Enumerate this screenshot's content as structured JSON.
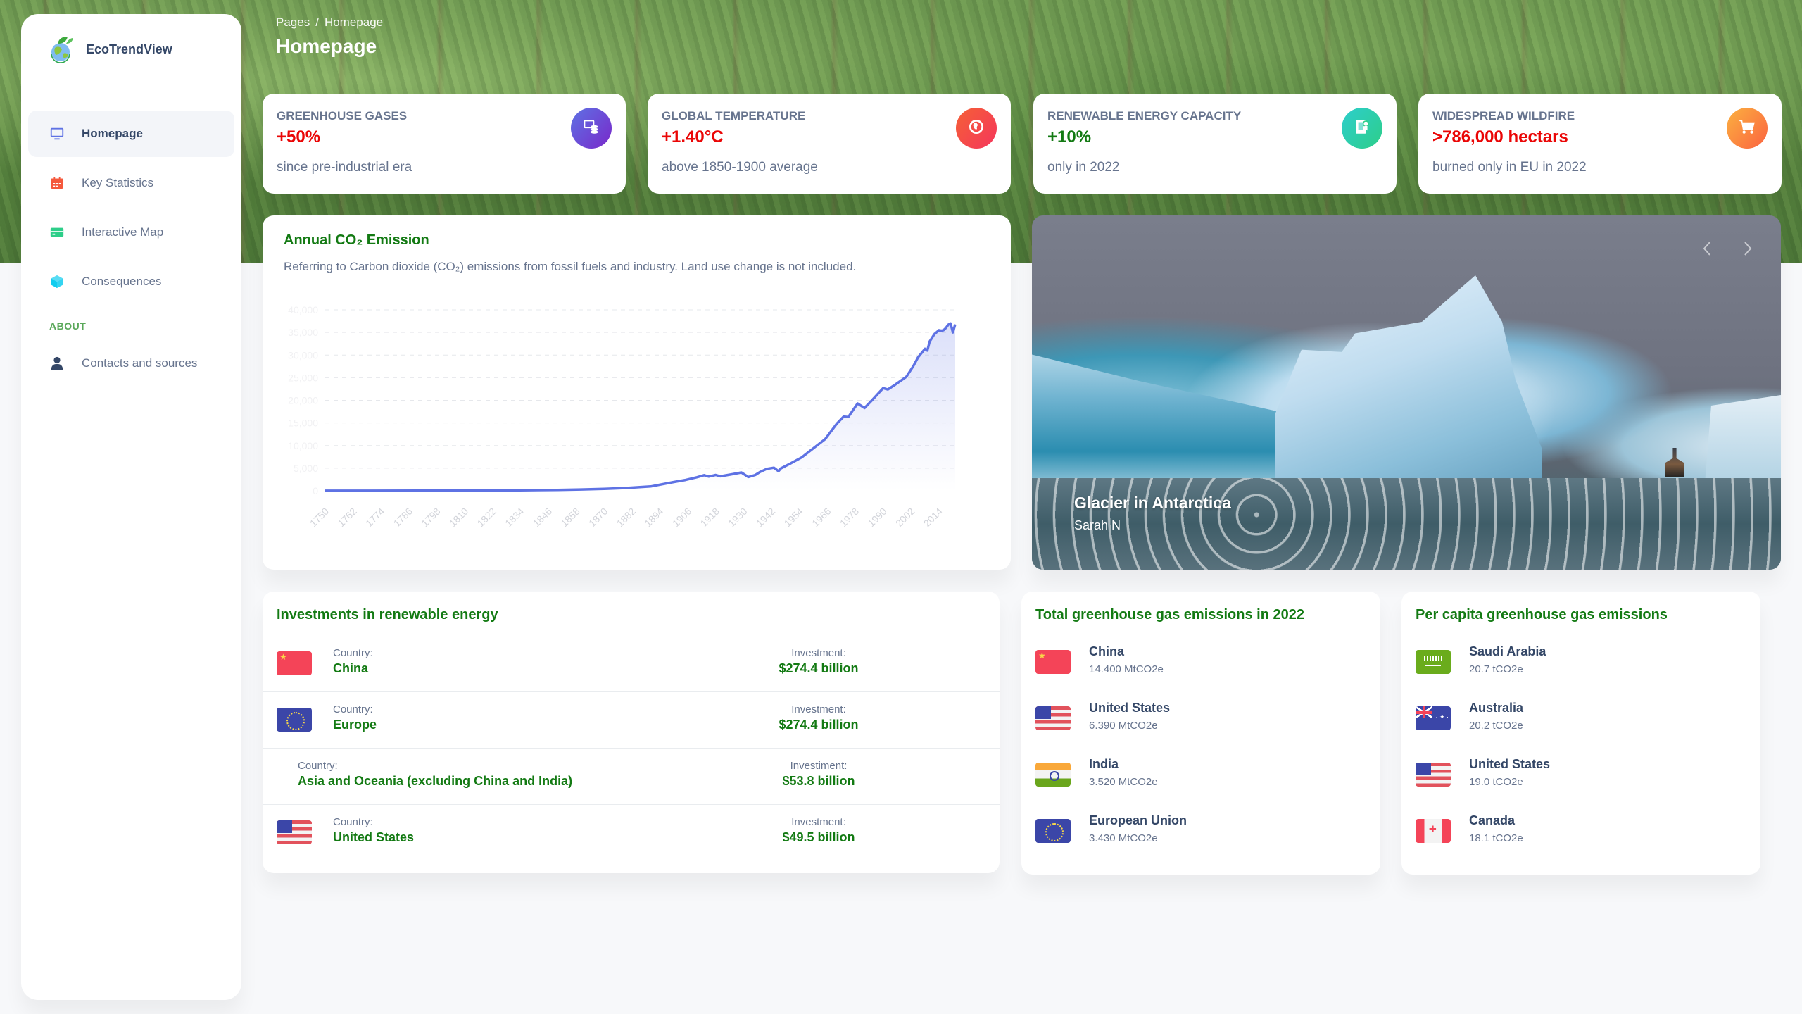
{
  "brand": {
    "name": "EcoTrendView",
    "logo_icon": "globe-leaf-icon"
  },
  "sidebar": {
    "items": [
      {
        "label": "Homepage",
        "icon": "monitor-icon",
        "icon_color": "#5e72e4",
        "active": true
      },
      {
        "label": "Key Statistics",
        "icon": "calendar-icon",
        "icon_color": "#f5593d",
        "active": false
      },
      {
        "label": "Interactive Map",
        "icon": "credit-card-icon",
        "icon_color": "#2dce89",
        "active": false
      },
      {
        "label": "Consequences",
        "icon": "box-icon",
        "icon_color": "#11cdef",
        "active": false
      }
    ],
    "section_label": "ABOUT",
    "about_items": [
      {
        "label": "Contacts and sources",
        "icon": "user-icon",
        "icon_color": "#344767"
      }
    ]
  },
  "header": {
    "breadcrumb": [
      "Pages",
      "Homepage"
    ],
    "breadcrumb_separator": "/",
    "title": "Homepage"
  },
  "stats": [
    {
      "title": "GREENHOUSE GASES",
      "value": "+50%",
      "value_color": "#ea0606",
      "subtitle": "since pre-industrial era",
      "icon": "money-coins-icon",
      "gradient": [
        "#7928ca",
        "#5e72e4"
      ]
    },
    {
      "title": "GLOBAL TEMPERATURE",
      "value": "+1.40°C",
      "value_color": "#ea0606",
      "subtitle": "above 1850-1900 average",
      "icon": "world-icon",
      "gradient": [
        "#f5365c",
        "#f56036"
      ]
    },
    {
      "title": "RENEWABLE ENERGY CAPACITY",
      "value": "+10%",
      "value_color": "#137a13",
      "subtitle": "only in 2022",
      "icon": "paper-diploma-icon",
      "gradient": [
        "#2dce89",
        "#2dcecc"
      ]
    },
    {
      "title": "WIDESPREAD WILDFIRE",
      "value": ">786,000 hectars",
      "value_color": "#ea0606",
      "subtitle": "burned only in EU in 2022",
      "icon": "cart-icon",
      "gradient": [
        "#fb6340",
        "#fbb140"
      ]
    }
  ],
  "chart_card": {
    "title": "Annual CO₂ Emission",
    "subtitle": "Referring to Carbon dioxide (CO₂) emissions from fossil fuels and industry. Land use change is not included."
  },
  "chart_data": {
    "type": "area",
    "title": "Annual CO₂ Emission",
    "xlabel": "",
    "ylabel": "",
    "xlim": [
      1750,
      2021
    ],
    "ylim": [
      0,
      40000
    ],
    "grid": true,
    "legend": "none",
    "line_color": "#5e72e4",
    "y_ticks": [
      0,
      5000,
      10000,
      15000,
      20000,
      25000,
      30000,
      35000,
      40000
    ],
    "y_tick_labels": [
      "0",
      "5,000",
      "10,000",
      "15,000",
      "20,000",
      "25,000",
      "30,000",
      "35,000",
      "40,000"
    ],
    "x_tick_labels": [
      "1750",
      "1762",
      "1774",
      "1786",
      "1798",
      "1810",
      "1822",
      "1834",
      "1846",
      "1858",
      "1870",
      "1882",
      "1894",
      "1906",
      "1918",
      "1930",
      "1942",
      "1954",
      "1966",
      "1978",
      "1990",
      "2002",
      "2014"
    ],
    "series": [
      {
        "name": "Annual CO₂ emissions (Mt)",
        "x": [
          1750,
          1770,
          1790,
          1810,
          1830,
          1850,
          1860,
          1870,
          1880,
          1890,
          1900,
          1905,
          1910,
          1913,
          1915,
          1918,
          1920,
          1925,
          1929,
          1932,
          1935,
          1937,
          1940,
          1943,
          1945,
          1946,
          1950,
          1955,
          1960,
          1965,
          1970,
          1973,
          1975,
          1979,
          1982,
          1985,
          1990,
          1992,
          1995,
          2000,
          2003,
          2005,
          2008,
          2009,
          2010,
          2012,
          2014,
          2015,
          2016,
          2017,
          2018,
          2019,
          2020,
          2021
        ],
        "y": [
          9,
          15,
          25,
          45,
          90,
          200,
          290,
          440,
          640,
          970,
          1950,
          2400,
          3000,
          3450,
          3150,
          3500,
          3200,
          3650,
          4050,
          3050,
          3500,
          4150,
          4850,
          5100,
          4350,
          4950,
          6000,
          7400,
          9400,
          11400,
          14800,
          16400,
          16300,
          19300,
          18300,
          19900,
          22700,
          22400,
          23400,
          25200,
          27600,
          29500,
          31400,
          31000,
          33000,
          34600,
          35500,
          35400,
          35500,
          36000,
          36700,
          37000,
          35000,
          36800
        ]
      }
    ]
  },
  "carousel": {
    "title": "Glacier in Antarctica",
    "subtitle": "Sarah N",
    "prev_icon": "chevron-left-icon",
    "next_icon": "chevron-right-icon"
  },
  "investments": {
    "title": "Investments in renewable energy",
    "rows": [
      {
        "flag": "cn",
        "country_label": "Country:",
        "country": "China",
        "investment_label": "Investment:",
        "investment": "$274.4 billion"
      },
      {
        "flag": "eu",
        "country_label": "Country:",
        "country": "Europe",
        "investment_label": "Investment:",
        "investment": "$274.4 billion"
      },
      {
        "flag": "",
        "country_label": "Country:",
        "country": "Asia and Oceania (excluding China and India)",
        "investment_label": "Investiment:",
        "investment": "$53.8 billion"
      },
      {
        "flag": "us",
        "country_label": "Country:",
        "country": "United States",
        "investment_label": "Investment:",
        "investment": "$49.5 billion"
      }
    ]
  },
  "total_emissions": {
    "title": "Total greenhouse gas emissions in 2022",
    "items": [
      {
        "flag": "cn",
        "name": "China",
        "value": "14.400 MtCO2e"
      },
      {
        "flag": "us",
        "name": "United States",
        "value": "6.390 MtCO2e"
      },
      {
        "flag": "in",
        "name": "India",
        "value": "3.520 MtCO2e"
      },
      {
        "flag": "eu",
        "name": "European Union",
        "value": "3.430 MtCO2e"
      }
    ]
  },
  "per_capita": {
    "title": "Per capita greenhouse gas emissions",
    "items": [
      {
        "flag": "sa",
        "name": "Saudi Arabia",
        "value": "20.7 tCO2e"
      },
      {
        "flag": "au",
        "name": "Australia",
        "value": "20.2 tCO2e"
      },
      {
        "flag": "us",
        "name": "United States",
        "value": "19.0 tCO2e"
      },
      {
        "flag": "ca",
        "name": "Canada",
        "value": "18.1 tCO2e"
      }
    ]
  }
}
